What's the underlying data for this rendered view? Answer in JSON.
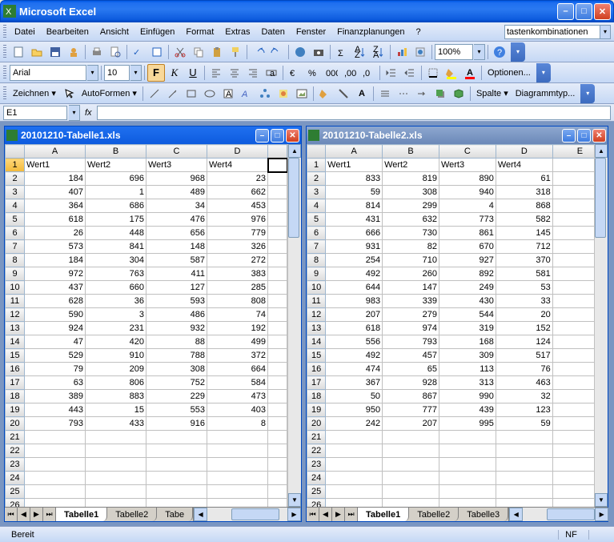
{
  "app": {
    "title": "Microsoft Excel"
  },
  "menu": {
    "items": [
      "Datei",
      "Bearbeiten",
      "Ansicht",
      "Einfügen",
      "Format",
      "Extras",
      "Daten",
      "Fenster",
      "Finanzplanungen",
      "?"
    ],
    "help_input": "tastenkombinationen"
  },
  "toolbars": {
    "font_name": "Arial",
    "font_size": "10",
    "zoom": "100%",
    "draw_label": "Zeichnen",
    "autoshapes_label": "AutoFormen",
    "options_label": "Optionen...",
    "column_label": "Spalte",
    "diagram_label": "Diagrammtyp..."
  },
  "formula": {
    "name_box": "E1",
    "fx": "fx",
    "value": ""
  },
  "windows": [
    {
      "id": "w1",
      "title": "20101210-Tabelle1.xls",
      "active": true,
      "cols": [
        "A",
        "B",
        "C",
        "D"
      ],
      "headers": [
        "Wert1",
        "Wert2",
        "Wert3",
        "Wert4"
      ],
      "rows": [
        [
          184,
          696,
          968,
          23
        ],
        [
          407,
          1,
          489,
          662
        ],
        [
          364,
          686,
          34,
          453
        ],
        [
          618,
          175,
          476,
          976
        ],
        [
          26,
          448,
          656,
          779
        ],
        [
          573,
          841,
          148,
          326
        ],
        [
          184,
          304,
          587,
          272
        ],
        [
          972,
          763,
          411,
          383
        ],
        [
          437,
          660,
          127,
          285
        ],
        [
          628,
          36,
          593,
          808
        ],
        [
          590,
          3,
          486,
          74
        ],
        [
          924,
          231,
          932,
          192
        ],
        [
          47,
          420,
          88,
          499
        ],
        [
          529,
          910,
          788,
          372
        ],
        [
          79,
          209,
          308,
          664
        ],
        [
          63,
          806,
          752,
          584
        ],
        [
          389,
          883,
          229,
          473
        ],
        [
          443,
          15,
          553,
          403
        ],
        [
          793,
          433,
          916,
          8
        ]
      ],
      "empty_rows": 6,
      "tabs": [
        "Tabelle1",
        "Tabelle2",
        "Tabe"
      ],
      "active_tab": 0,
      "selected_cell": {
        "r": 0,
        "c": 4
      }
    },
    {
      "id": "w2",
      "title": "20101210-Tabelle2.xls",
      "active": false,
      "cols": [
        "A",
        "B",
        "C",
        "D",
        "E"
      ],
      "headers": [
        "Wert1",
        "Wert2",
        "Wert3",
        "Wert4",
        ""
      ],
      "rows": [
        [
          833,
          819,
          890,
          61
        ],
        [
          59,
          308,
          940,
          318
        ],
        [
          814,
          299,
          4,
          868
        ],
        [
          431,
          632,
          773,
          582
        ],
        [
          666,
          730,
          861,
          145
        ],
        [
          931,
          82,
          670,
          712
        ],
        [
          254,
          710,
          927,
          370
        ],
        [
          492,
          260,
          892,
          581
        ],
        [
          644,
          147,
          249,
          53
        ],
        [
          983,
          339,
          430,
          33
        ],
        [
          207,
          279,
          544,
          20
        ],
        [
          618,
          974,
          319,
          152
        ],
        [
          556,
          793,
          168,
          124
        ],
        [
          492,
          457,
          309,
          517
        ],
        [
          474,
          65,
          113,
          76
        ],
        [
          367,
          928,
          313,
          463
        ],
        [
          50,
          867,
          990,
          32
        ],
        [
          950,
          777,
          439,
          123
        ],
        [
          242,
          207,
          995,
          59
        ]
      ],
      "empty_rows": 6,
      "tabs": [
        "Tabelle1",
        "Tabelle2",
        "Tabelle3"
      ],
      "active_tab": 0
    }
  ],
  "status": {
    "ready": "Bereit",
    "nf": "NF"
  }
}
